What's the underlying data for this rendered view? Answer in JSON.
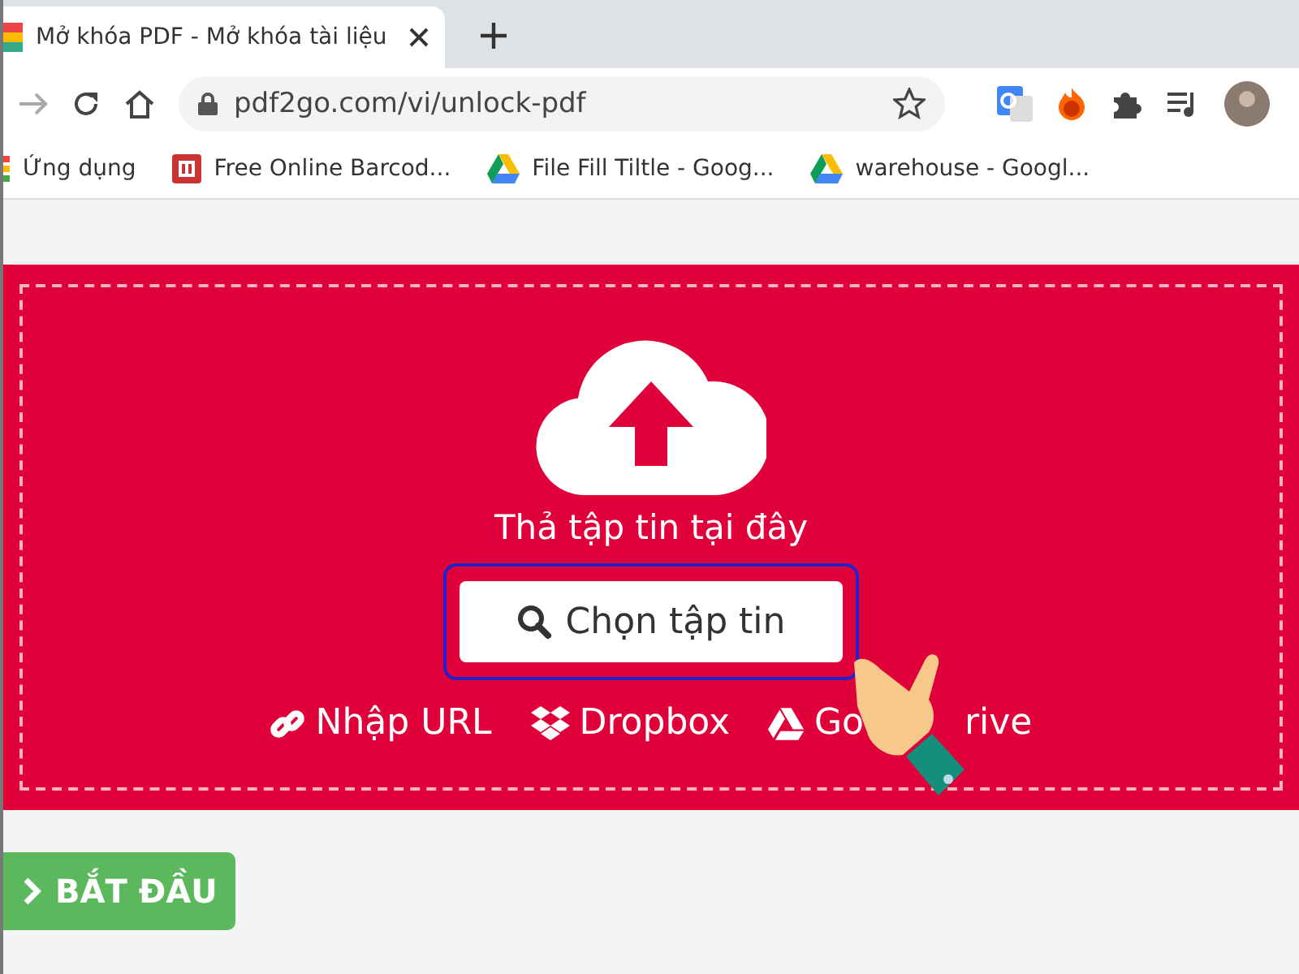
{
  "browser": {
    "tab": {
      "title": "Mở khóa PDF - Mở khóa tài liệu",
      "selected": true
    },
    "address": "pdf2go.com/vi/unlock-pdf",
    "bookmarks": [
      {
        "label": "Ứng dụng",
        "kind": "apps"
      },
      {
        "label": "Free Online Barcod...",
        "kind": "barcode"
      },
      {
        "label": "File Fill Tiltle - Goog...",
        "kind": "drive"
      },
      {
        "label": "warehouse - Googl...",
        "kind": "drive"
      }
    ]
  },
  "upload": {
    "drop_text": "Thả tập tin tại đây",
    "choose_button": "Chọn tập tin",
    "sources": [
      {
        "label": "Nhập URL",
        "kind": "link"
      },
      {
        "label": "Dropbox",
        "kind": "dropbox"
      },
      {
        "label": "Go",
        "label_after": "rive",
        "kind": "drive"
      }
    ]
  },
  "start_button": "BẮT ĐẦU"
}
